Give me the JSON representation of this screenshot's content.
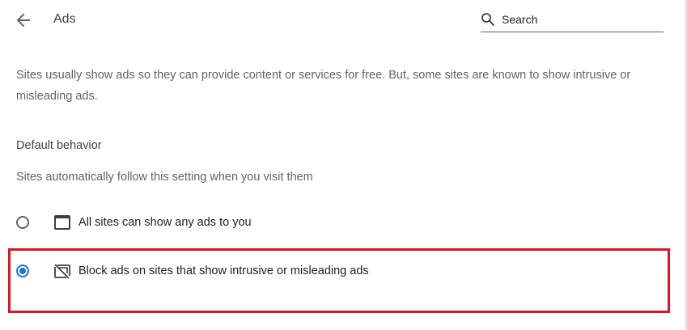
{
  "header": {
    "title": "Ads",
    "back_icon": "arrow-back-icon",
    "search": {
      "placeholder": "Search",
      "value": "",
      "icon": "search-icon"
    }
  },
  "main": {
    "description": "Sites usually show ads so they can provide content or services for free. But, some sites are known to show intrusive or misleading ads.",
    "default_behavior": {
      "heading": "Default behavior",
      "subtitle": "Sites automatically follow this setting when you visit them",
      "options": [
        {
          "label": "All sites can show any ads to you",
          "icon": "web-window-icon",
          "selected": false
        },
        {
          "label": "Block ads on sites that show intrusive or misleading ads",
          "icon": "ads-blocked-icon",
          "selected": true
        }
      ]
    }
  },
  "colors": {
    "accent": "#1a73e8",
    "highlight": "#e0131f",
    "text_primary": "#202124",
    "text_secondary": "#5f6368"
  }
}
